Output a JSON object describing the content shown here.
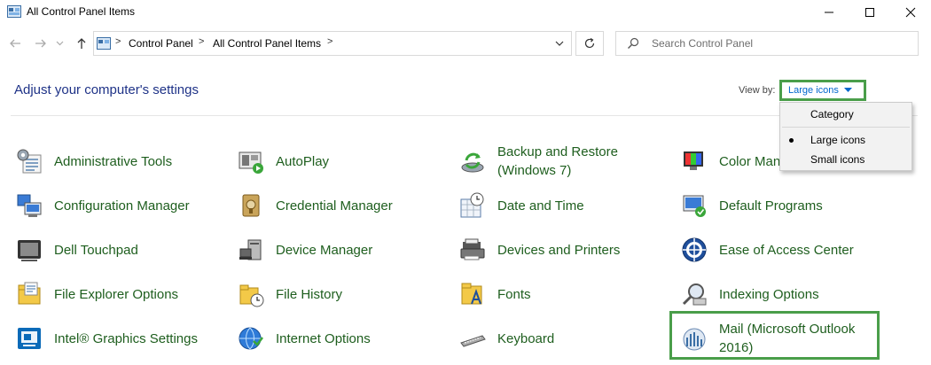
{
  "window": {
    "title": "All Control Panel Items",
    "minimize_symbol": "—",
    "maximize_symbol": "☐",
    "close_symbol": "✕"
  },
  "nav": {
    "back_icon": "arrow-left-icon",
    "forward_icon": "arrow-right-icon",
    "recent_icon": "chevron-down-icon",
    "up_icon": "arrow-up-icon",
    "breadcrumb": [
      "Control Panel",
      "All Control Panel Items"
    ],
    "separator": ">",
    "refresh_icon": "refresh-icon",
    "search_placeholder": "Search Control Panel"
  },
  "header": {
    "heading": "Adjust your computer's settings",
    "view_by_label": "View by:",
    "view_by_value": "Large icons",
    "view_by_options": [
      "Category",
      "Large icons",
      "Small icons"
    ],
    "view_by_selected": "Large icons"
  },
  "items": [
    {
      "label": "Administrative Tools",
      "icon": "admin-tools-icon"
    },
    {
      "label": "AutoPlay",
      "icon": "autoplay-icon"
    },
    {
      "label": "Backup and Restore (Windows 7)",
      "icon": "backup-restore-icon"
    },
    {
      "label": "Color Management",
      "icon": "color-management-icon"
    },
    {
      "label": "Configuration Manager",
      "icon": "configuration-manager-icon"
    },
    {
      "label": "Credential Manager",
      "icon": "credential-manager-icon"
    },
    {
      "label": "Date and Time",
      "icon": "date-time-icon"
    },
    {
      "label": "Default Programs",
      "icon": "default-programs-icon"
    },
    {
      "label": "Dell Touchpad",
      "icon": "touchpad-icon"
    },
    {
      "label": "Device Manager",
      "icon": "device-manager-icon"
    },
    {
      "label": "Devices and Printers",
      "icon": "devices-printers-icon"
    },
    {
      "label": "Ease of Access Center",
      "icon": "ease-of-access-icon"
    },
    {
      "label": "File Explorer Options",
      "icon": "folder-options-icon"
    },
    {
      "label": "File History",
      "icon": "file-history-icon"
    },
    {
      "label": "Fonts",
      "icon": "fonts-icon"
    },
    {
      "label": "Indexing Options",
      "icon": "indexing-options-icon"
    },
    {
      "label": "Intel® Graphics Settings",
      "icon": "intel-graphics-icon"
    },
    {
      "label": "Internet Options",
      "icon": "internet-options-icon"
    },
    {
      "label": "Keyboard",
      "icon": "keyboard-icon"
    },
    {
      "label": "Mail (Microsoft Outlook 2016)",
      "icon": "mail-icon"
    }
  ],
  "colors": {
    "link_green": "#1e5e1e",
    "heading_blue": "#1e3287",
    "highlight_green": "#4a9e4a",
    "dropdown_blue": "#0066cc"
  }
}
